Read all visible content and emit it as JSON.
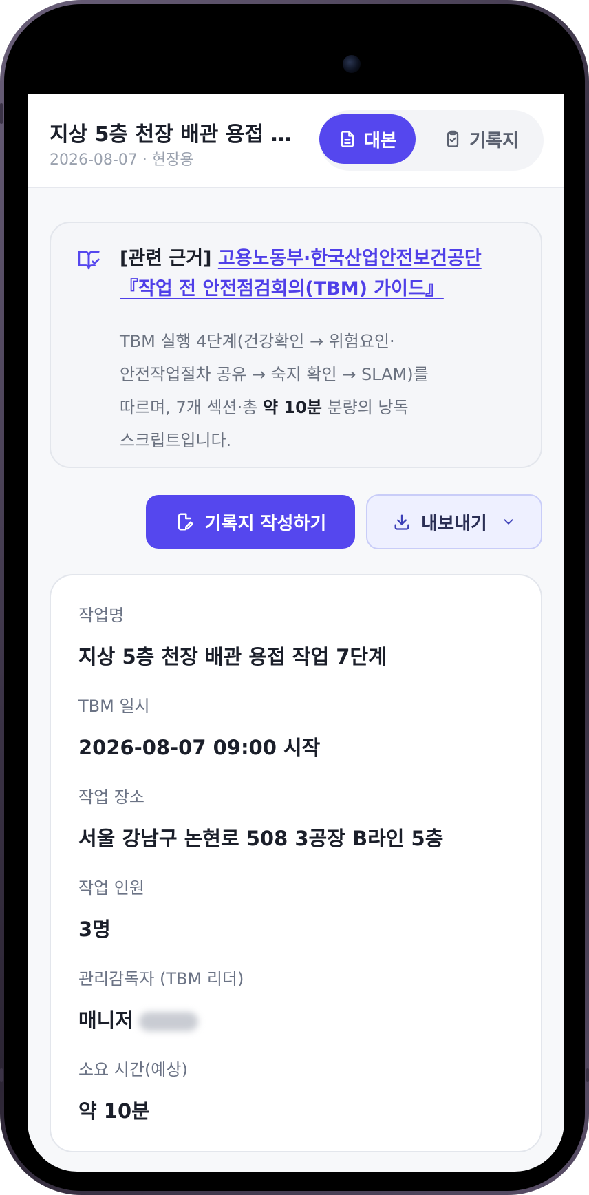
{
  "header": {
    "title": "지상 5층 천장 배관 용접 작...",
    "subtitle": "2026-08-07 · 현장용",
    "tabs": [
      {
        "label": "대본",
        "icon": "document-icon",
        "active": true
      },
      {
        "label": "기록지",
        "icon": "clipboard-check-icon",
        "active": false
      }
    ]
  },
  "reference": {
    "prefix": "[관련 근거]",
    "link_line1": "고용노동부·한국산업안전보건공단",
    "link_line2": "『작업 전 안전점검회의(TBM) 가이드』",
    "body_line1": "TBM 실행 4단계(건강확인 → 위험요인·",
    "body_line2": "안전작업절차 공유 → 숙지 확인 → SLAM)를",
    "body_line3_pre": "따르며, 7개 섹션·총 ",
    "body_line3_bold": "약 10분",
    "body_line3_post": " 분량의 낭독",
    "body_line4": "스크립트입니다."
  },
  "actions": {
    "write_label": "기록지 작성하기",
    "export_label": "내보내기"
  },
  "details": [
    {
      "label": "작업명",
      "value": "지상 5층 천장 배관 용접 작업 7단계"
    },
    {
      "label": "TBM 일시",
      "value": "2026-08-07 09:00 시작"
    },
    {
      "label": "작업 장소",
      "value": "서울 강남구 논현로 508 3공장 B라인 5층"
    },
    {
      "label": "작업 인원",
      "value": "3명"
    },
    {
      "label": "관리감독자 (TBM 리더)",
      "value": "매니저"
    },
    {
      "label": "소요 시간(예상)",
      "value": "약 10분"
    }
  ],
  "colors": {
    "accent": "#5547ee",
    "link": "#4f3fe8",
    "text_primary": "#1b1f2a",
    "text_muted": "#6b7385"
  }
}
